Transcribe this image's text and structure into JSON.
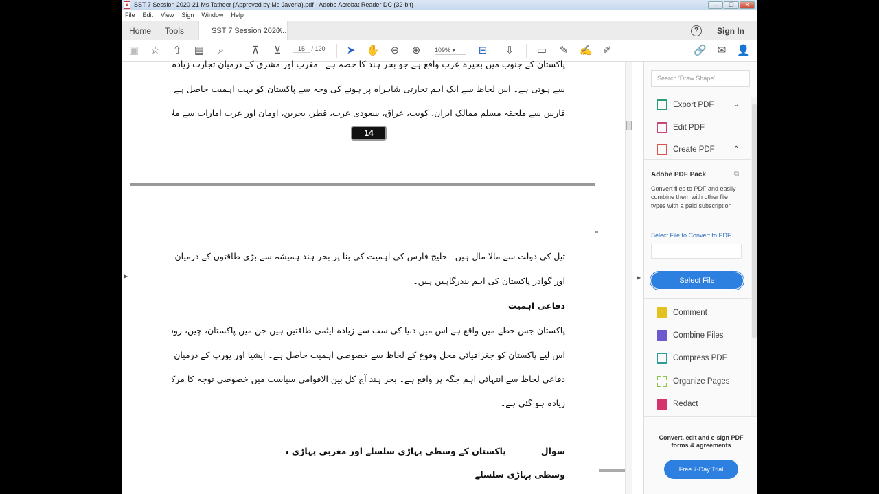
{
  "window": {
    "title": "SST 7 Session 2020-21 Ms Tatheer (Approved by Ms Javeria).pdf - Adobe Acrobat Reader DC (32-bit)"
  },
  "menu": [
    "File",
    "Edit",
    "View",
    "Sign",
    "Window",
    "Help"
  ],
  "tabs": {
    "home": "Home",
    "tools": "Tools",
    "doc": "SST 7 Session 2020...",
    "close": "×"
  },
  "header": {
    "help": "?",
    "sign_in": "Sign In"
  },
  "toolbar": {
    "page_current": "15",
    "page_total": "/ 120",
    "zoom": "109%"
  },
  "document": {
    "page_number": "14",
    "page1_lines": [
      "پاکستان کے جنوب میں بحیرہ عرب واقع ہے جو بحر ہند کا حصہ ہے۔ مغرب اور مشرق کے درمیان تجارت زیادہ تر بحر ہند کے راستے",
      "سے ہوتی ہے۔ اس لحاظ سے ایک اہم تجارتی شاہراہ پر ہونے کی وجہ سے پاکستان کو بہت اہمیت حاصل ہے۔ پاکستان بحیرہ عرب کے راستے خلیج",
      "فارس سے ملحقہ مسلم ممالک ایران، کویت، عراق، سعودی عرب، قطر، بحرین، اومان اور عرب امارات سے ملا ہوا ہے۔ یہ تمام خلیجی ممالک"
    ],
    "page2_lines": [
      "تیل کی دولت سے مالا مال ہیں۔ خلیج فارس کی اہمیت کی بنا پر بحر ہند ہمیشہ سے بڑی طاقتوں کے درمیان توجہ کا مرکز رہا ہے۔ کراچی، پورٹ قاسم",
      "اور گوادر پاکستان کی اہم بندرگاہیں ہیں۔"
    ],
    "heading_defense": "دفاعی اہمیت",
    "defense_lines": [
      "پاکستان جس خطے میں واقع ہے اس میں دنیا کی سب سے زیادہ ایٹمی طاقتیں ہیں جن میں پاکستان، چین، روس اور بھارت شامل ہیں۔",
      "اس لیے پاکستان کو جغرافیائی محل وقوع کے لحاظ سے خصوصی اہمیت حاصل ہے۔ ایشیا اور یورپ کے درمیان بحری رابطے کی وجہ سے پاکستان",
      "دفاعی لحاظ سے انتہائی اہم جگہ پر واقع ہے۔ بحر ہند آج کل بین الاقوامی سیاست میں خصوصی توجہ کا مرکز ہے اس لیے پاکستان کی اہمیت پہلے سے",
      "زیادہ ہو گئی ہے۔"
    ],
    "question_label": "سوال",
    "question_text": "پاکستان کے وسطی پہاڑی سلسلے اور مغربی پہاڑی سلسلوں پر نوٹ لکھیں۔",
    "subheading": "وسطی پہاڑی سلسلے"
  },
  "right_pane": {
    "search_placeholder": "Search 'Draw Shape'",
    "tools": [
      {
        "label": "Export PDF",
        "color": "#2a9d7a"
      },
      {
        "label": "Edit PDF",
        "color": "#c8457a"
      },
      {
        "label": "Create PDF",
        "color": "#d9534f"
      }
    ],
    "pack_title": "Adobe PDF Pack",
    "pack_desc": "Convert files to PDF and easily combine them with other file types with a paid subscription",
    "select_label": "Select File to Convert to PDF",
    "select_button": "Select File",
    "tools2": [
      {
        "label": "Comment",
        "color": "#e3c21e"
      },
      {
        "label": "Combine Files",
        "color": "#6a5acd"
      },
      {
        "label": "Compress PDF",
        "color": "#2a9d9a"
      },
      {
        "label": "Organize Pages",
        "color": "#8bc34a"
      },
      {
        "label": "Redact",
        "color": "#d6336c"
      }
    ],
    "promo": "Convert, edit and e-sign PDF forms & agreements",
    "trial_button": "Free 7-Day Trial"
  }
}
